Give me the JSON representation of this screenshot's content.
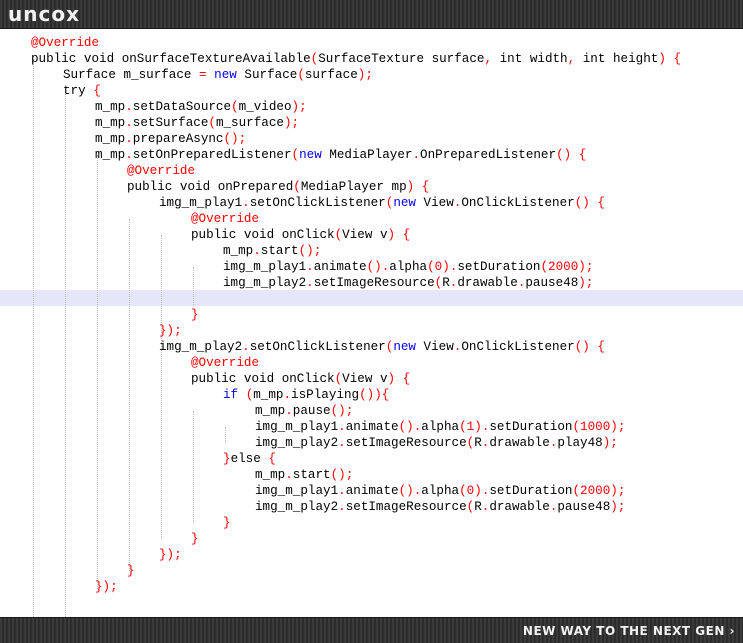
{
  "header": {
    "logo_text": "uncox"
  },
  "footer": {
    "tagline": "NEW WAY TO THE NEXT GEN ›"
  },
  "colors": {
    "annotation": "#ff0000",
    "keyword": "#0000ff",
    "number": "#ff0000",
    "highlight_line": "#e6e6fa"
  },
  "code": {
    "highlighted_line": 16,
    "lines": [
      {
        "indent": 0,
        "tokens": [
          [
            "ann",
            "@Override"
          ]
        ]
      },
      {
        "indent": 0,
        "tokens": [
          [
            "id",
            "public void onSurfaceTextureAvailable"
          ],
          [
            "op",
            "("
          ],
          [
            "id",
            "SurfaceTexture surface"
          ],
          [
            "op",
            ", "
          ],
          [
            "id",
            "int width"
          ],
          [
            "op",
            ", "
          ],
          [
            "id",
            "int height"
          ],
          [
            "op",
            ") {"
          ]
        ]
      },
      {
        "indent": 1,
        "tokens": [
          [
            "id",
            "Surface m_surface "
          ],
          [
            "op",
            "= "
          ],
          [
            "kw",
            "new "
          ],
          [
            "id",
            "Surface"
          ],
          [
            "op",
            "("
          ],
          [
            "id",
            "surface"
          ],
          [
            "op",
            ");"
          ]
        ]
      },
      {
        "indent": 1,
        "tokens": [
          [
            "id",
            "try "
          ],
          [
            "op",
            "{"
          ]
        ]
      },
      {
        "indent": 2,
        "tokens": [
          [
            "id",
            "m_mp"
          ],
          [
            "op",
            "."
          ],
          [
            "id",
            "setDataSource"
          ],
          [
            "op",
            "("
          ],
          [
            "id",
            "m_video"
          ],
          [
            "op",
            ");"
          ]
        ]
      },
      {
        "indent": 2,
        "tokens": [
          [
            "id",
            "m_mp"
          ],
          [
            "op",
            "."
          ],
          [
            "id",
            "setSurface"
          ],
          [
            "op",
            "("
          ],
          [
            "id",
            "m_surface"
          ],
          [
            "op",
            ");"
          ]
        ]
      },
      {
        "indent": 2,
        "tokens": [
          [
            "id",
            "m_mp"
          ],
          [
            "op",
            "."
          ],
          [
            "id",
            "prepareAsync"
          ],
          [
            "op",
            "();"
          ]
        ]
      },
      {
        "indent": 2,
        "tokens": [
          [
            "id",
            "m_mp"
          ],
          [
            "op",
            "."
          ],
          [
            "id",
            "setOnPreparedListener"
          ],
          [
            "op",
            "("
          ],
          [
            "kw",
            "new "
          ],
          [
            "id",
            "MediaPlayer"
          ],
          [
            "op",
            "."
          ],
          [
            "id",
            "OnPreparedListener"
          ],
          [
            "op",
            "() {"
          ]
        ]
      },
      {
        "indent": 3,
        "tokens": [
          [
            "ann",
            "@Override"
          ]
        ]
      },
      {
        "indent": 3,
        "tokens": [
          [
            "id",
            "public void onPrepared"
          ],
          [
            "op",
            "("
          ],
          [
            "id",
            "MediaPlayer mp"
          ],
          [
            "op",
            ") {"
          ]
        ]
      },
      {
        "indent": 4,
        "tokens": [
          [
            "id",
            "img_m_play1"
          ],
          [
            "op",
            "."
          ],
          [
            "id",
            "setOnClickListener"
          ],
          [
            "op",
            "("
          ],
          [
            "kw",
            "new "
          ],
          [
            "id",
            "View"
          ],
          [
            "op",
            "."
          ],
          [
            "id",
            "OnClickListener"
          ],
          [
            "op",
            "() {"
          ]
        ]
      },
      {
        "indent": 5,
        "tokens": [
          [
            "ann",
            "@Override"
          ]
        ]
      },
      {
        "indent": 5,
        "tokens": [
          [
            "id",
            "public void onClick"
          ],
          [
            "op",
            "("
          ],
          [
            "id",
            "View v"
          ],
          [
            "op",
            ") {"
          ]
        ]
      },
      {
        "indent": 6,
        "tokens": [
          [
            "id",
            "m_mp"
          ],
          [
            "op",
            "."
          ],
          [
            "id",
            "start"
          ],
          [
            "op",
            "();"
          ]
        ]
      },
      {
        "indent": 6,
        "tokens": [
          [
            "id",
            "img_m_play1"
          ],
          [
            "op",
            "."
          ],
          [
            "id",
            "animate"
          ],
          [
            "op",
            "()."
          ],
          [
            "id",
            "alpha"
          ],
          [
            "op",
            "("
          ],
          [
            "num",
            "0"
          ],
          [
            "op",
            ")."
          ],
          [
            "id",
            "setDuration"
          ],
          [
            "op",
            "("
          ],
          [
            "num",
            "2000"
          ],
          [
            "op",
            ");"
          ]
        ]
      },
      {
        "indent": 6,
        "tokens": [
          [
            "id",
            "img_m_play2"
          ],
          [
            "op",
            "."
          ],
          [
            "id",
            "setImageResource"
          ],
          [
            "op",
            "("
          ],
          [
            "id",
            "R"
          ],
          [
            "op",
            "."
          ],
          [
            "id",
            "drawable"
          ],
          [
            "op",
            "."
          ],
          [
            "id",
            "pause48"
          ],
          [
            "op",
            ");"
          ]
        ]
      },
      {
        "indent": 6,
        "tokens": []
      },
      {
        "indent": 5,
        "tokens": [
          [
            "op",
            "}"
          ]
        ]
      },
      {
        "indent": 4,
        "tokens": [
          [
            "op",
            "});"
          ]
        ]
      },
      {
        "indent": 4,
        "tokens": [
          [
            "id",
            "img_m_play2"
          ],
          [
            "op",
            "."
          ],
          [
            "id",
            "setOnClickListener"
          ],
          [
            "op",
            "("
          ],
          [
            "kw",
            "new "
          ],
          [
            "id",
            "View"
          ],
          [
            "op",
            "."
          ],
          [
            "id",
            "OnClickListener"
          ],
          [
            "op",
            "() {"
          ]
        ]
      },
      {
        "indent": 5,
        "tokens": [
          [
            "ann",
            "@Override"
          ]
        ]
      },
      {
        "indent": 5,
        "tokens": [
          [
            "id",
            "public void onClick"
          ],
          [
            "op",
            "("
          ],
          [
            "id",
            "View v"
          ],
          [
            "op",
            ") {"
          ]
        ]
      },
      {
        "indent": 6,
        "tokens": [
          [
            "kw",
            "if "
          ],
          [
            "op",
            "("
          ],
          [
            "id",
            "m_mp"
          ],
          [
            "op",
            "."
          ],
          [
            "id",
            "isPlaying"
          ],
          [
            "op",
            "()){"
          ]
        ]
      },
      {
        "indent": 7,
        "tokens": [
          [
            "id",
            "m_mp"
          ],
          [
            "op",
            "."
          ],
          [
            "id",
            "pause"
          ],
          [
            "op",
            "();"
          ]
        ]
      },
      {
        "indent": 7,
        "tokens": [
          [
            "id",
            "img_m_play1"
          ],
          [
            "op",
            "."
          ],
          [
            "id",
            "animate"
          ],
          [
            "op",
            "()."
          ],
          [
            "id",
            "alpha"
          ],
          [
            "op",
            "("
          ],
          [
            "num",
            "1"
          ],
          [
            "op",
            ")."
          ],
          [
            "id",
            "setDuration"
          ],
          [
            "op",
            "("
          ],
          [
            "num",
            "1000"
          ],
          [
            "op",
            ");"
          ]
        ]
      },
      {
        "indent": 7,
        "tokens": [
          [
            "id",
            "img_m_play2"
          ],
          [
            "op",
            "."
          ],
          [
            "id",
            "setImageResource"
          ],
          [
            "op",
            "("
          ],
          [
            "id",
            "R"
          ],
          [
            "op",
            "."
          ],
          [
            "id",
            "drawable"
          ],
          [
            "op",
            "."
          ],
          [
            "id",
            "play48"
          ],
          [
            "op",
            ");"
          ]
        ]
      },
      {
        "indent": 6,
        "tokens": [
          [
            "op",
            "}"
          ],
          [
            "id",
            "else "
          ],
          [
            "op",
            "{"
          ]
        ]
      },
      {
        "indent": 7,
        "tokens": [
          [
            "id",
            "m_mp"
          ],
          [
            "op",
            "."
          ],
          [
            "id",
            "start"
          ],
          [
            "op",
            "();"
          ]
        ]
      },
      {
        "indent": 7,
        "tokens": [
          [
            "id",
            "img_m_play1"
          ],
          [
            "op",
            "."
          ],
          [
            "id",
            "animate"
          ],
          [
            "op",
            "()."
          ],
          [
            "id",
            "alpha"
          ],
          [
            "op",
            "("
          ],
          [
            "num",
            "0"
          ],
          [
            "op",
            ")."
          ],
          [
            "id",
            "setDuration"
          ],
          [
            "op",
            "("
          ],
          [
            "num",
            "2000"
          ],
          [
            "op",
            ");"
          ]
        ]
      },
      {
        "indent": 7,
        "tokens": [
          [
            "id",
            "img_m_play2"
          ],
          [
            "op",
            "."
          ],
          [
            "id",
            "setImageResource"
          ],
          [
            "op",
            "("
          ],
          [
            "id",
            "R"
          ],
          [
            "op",
            "."
          ],
          [
            "id",
            "drawable"
          ],
          [
            "op",
            "."
          ],
          [
            "id",
            "pause48"
          ],
          [
            "op",
            ");"
          ]
        ]
      },
      {
        "indent": 6,
        "tokens": [
          [
            "op",
            "}"
          ]
        ]
      },
      {
        "indent": 5,
        "tokens": [
          [
            "op",
            "}"
          ]
        ]
      },
      {
        "indent": 4,
        "tokens": [
          [
            "op",
            "});"
          ]
        ]
      },
      {
        "indent": 3,
        "tokens": [
          [
            "op",
            "}"
          ]
        ]
      },
      {
        "indent": 2,
        "tokens": [
          [
            "op",
            "});"
          ]
        ]
      }
    ]
  }
}
